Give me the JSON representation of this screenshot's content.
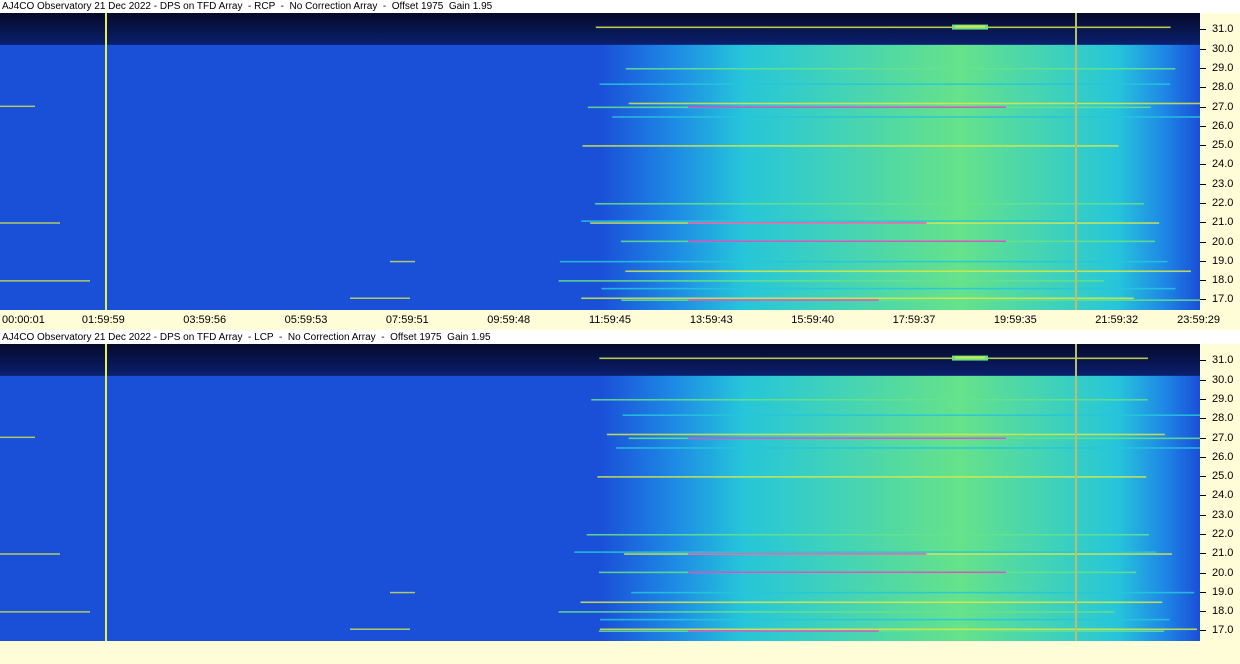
{
  "chart_data": [
    {
      "type": "heatmap",
      "title": "AJ4CO Observatory 21 Dec 2022 - DPS on TFD Array  - RCP  -  No Correction Array  -  Offset 1975  Gain 1.95",
      "x_tick_labels": [
        "00:00:01",
        "01:59:59",
        "03:59:56",
        "05:59:53",
        "07:59:51",
        "09:59:48",
        "11:59:45",
        "13:59:43",
        "15:59:40",
        "17:59:37",
        "19:59:35",
        "21:59:32",
        "23:59:29"
      ],
      "y_tick_labels": [
        "31.0",
        "30.0",
        "29.0",
        "28.0",
        "27.0",
        "26.0",
        "25.0",
        "24.0",
        "23.0",
        "22.0",
        "21.0",
        "20.0",
        "19.0",
        "18.0",
        "17.0"
      ],
      "y_values": [
        31.0,
        30.0,
        29.0,
        28.0,
        27.0,
        26.0,
        25.0,
        24.0,
        23.0,
        22.0,
        21.0,
        20.0,
        19.0,
        18.0,
        17.0
      ],
      "ylim": [
        16.45,
        31.85
      ],
      "colormap": [
        "#0a1f6e",
        "#1a4fd8",
        "#1e88e5",
        "#26c6da",
        "#66e28a",
        "#d7e84a",
        "#ff4d4d",
        "#ff2bd0"
      ],
      "markers_hours": [
        2.1,
        21.5
      ],
      "marker_colors": [
        "#e6f04a",
        "#b7c070"
      ],
      "sun_band_hours": [
        12.7,
        23.3
      ]
    },
    {
      "type": "heatmap",
      "title": "AJ4CO Observatory 21 Dec 2022 - DPS on TFD Array  - LCP  -  No Correction Array  -  Offset 1975  Gain 1.95",
      "x_tick_labels": [],
      "y_tick_labels": [
        "31.0",
        "30.0",
        "29.0",
        "28.0",
        "27.0",
        "26.0",
        "25.0",
        "24.0",
        "23.0",
        "22.0",
        "21.0",
        "20.0",
        "19.0",
        "18.0",
        "17.0"
      ],
      "y_values": [
        31.0,
        30.0,
        29.0,
        28.0,
        27.0,
        26.0,
        25.0,
        24.0,
        23.0,
        22.0,
        21.0,
        20.0,
        19.0,
        18.0,
        17.0
      ],
      "ylim": [
        16.45,
        31.85
      ],
      "colormap": [
        "#0a1f6e",
        "#1a4fd8",
        "#1e88e5",
        "#26c6da",
        "#66e28a",
        "#d7e84a",
        "#ff4d4d",
        "#ff2bd0"
      ],
      "markers_hours": [
        2.1,
        21.5
      ],
      "marker_colors": [
        "#e6f04a",
        "#b7c070"
      ],
      "sun_band_hours": [
        12.7,
        23.3
      ]
    }
  ]
}
